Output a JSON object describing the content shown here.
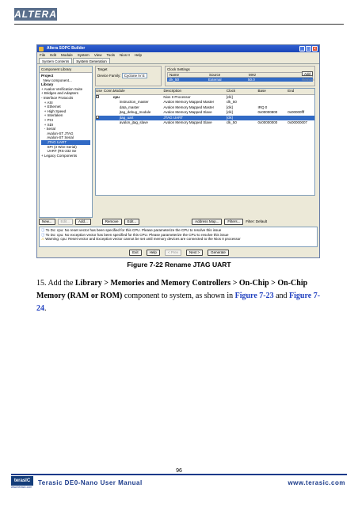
{
  "header": {
    "logo_text": "ALTERA"
  },
  "window": {
    "title": "Altera SOPC Builder",
    "menu": [
      "File",
      "Edit",
      "Module",
      "System",
      "View",
      "Tools",
      "Nios II",
      "Help"
    ],
    "tabs": [
      "System Contents",
      "System Generation"
    ],
    "library": {
      "title": "Component Library",
      "items": [
        {
          "text": "Project",
          "bold": true
        },
        {
          "text": "  New component..."
        },
        {
          "text": "Library",
          "bold": true
        },
        {
          "text": "+ Avalon Verification Suite"
        },
        {
          "text": "+ Bridges and Adapters"
        },
        {
          "text": "- Interface Protocols"
        },
        {
          "text": "   + ASI"
        },
        {
          "text": "   + Ethernet"
        },
        {
          "text": "   + High Speed"
        },
        {
          "text": "   + Interlaken"
        },
        {
          "text": "   + PCI"
        },
        {
          "text": "   + SDI"
        },
        {
          "text": "   - Serial"
        },
        {
          "text": "      Avalon-ST JTAG"
        },
        {
          "text": "      Avalon-ST Serial"
        },
        {
          "text": "      JTAG UART",
          "selected": true
        },
        {
          "text": "      SPI (3 Wire Serial)"
        },
        {
          "text": "      UART (RS-232 Se"
        },
        {
          "text": "+ Legacy Components"
        }
      ]
    },
    "target": {
      "title": "Target",
      "family_label": "Device Family:",
      "family_value": "Cyclone IV E"
    },
    "clock": {
      "title": "Clock Settings",
      "headers": [
        "Name",
        "Source",
        "MHz"
      ],
      "row": [
        "clk_50",
        "External",
        "50.0"
      ],
      "add": "Add",
      "remove": "Remove"
    },
    "table": {
      "headers": [
        "Use",
        "Conn...",
        "Module",
        "Description",
        "Clock",
        "Base",
        "End"
      ],
      "rows": [
        {
          "use": "",
          "module": "cpu",
          "desc": "Nios II Processor",
          "clock": "[clk]",
          "base": "",
          "end": "",
          "bold": true
        },
        {
          "use": "",
          "module": "instruction_master",
          "desc": "Avalon Memory Mapped Master",
          "clock": "clk_50",
          "base": "",
          "end": ""
        },
        {
          "use": "",
          "module": "data_master",
          "desc": "Avalon Memory Mapped Master",
          "clock": "[clk]",
          "base": "IRQ 0",
          "end": ""
        },
        {
          "use": "",
          "module": "jtag_debug_module",
          "desc": "Avalon Memory Mapped Slave",
          "clock": "[clk]",
          "base": "0x00000800",
          "end": "0x00000fff"
        },
        {
          "use": "",
          "module": "jtag_uart",
          "desc": "JTAG UART",
          "clock": "[clk]",
          "base": "",
          "end": "",
          "highlight": true
        },
        {
          "use": "",
          "module": "avalon_jtag_slave",
          "desc": "Avalon Memory Mapped Slave",
          "clock": "clk_50",
          "base": "0x00000000",
          "end": "0x00000007"
        }
      ]
    },
    "buttons": [
      "New...",
      "Edit...",
      "Add...",
      "Remove",
      "Edit...",
      "Address Map...",
      "Filters..."
    ],
    "filter_text": "Filter: Default",
    "messages": [
      "To Do: cpu: No reset vector has been specified for this CPU. Please parameterize the CPU to resolve this issue",
      "To Do: cpu: No exception vector has been specified for this CPU. Please parameterize the CPU to resolve this issue",
      "Warning: cpu: Reset vector and Exception vector cannot be set until memory devices are connected to the Nios II processor"
    ],
    "footer_buttons": [
      "Exit",
      "Help",
      "< Prev",
      "Next >",
      "Generate"
    ]
  },
  "caption": "Figure 7-22 Rename JTAG UART",
  "paragraph": {
    "num": "15. Add the ",
    "path": "Library > Memories and Memory Controllers > On-Chip > On-Chip Memory (RAM or ROM)",
    "mid": " component to system, as shown in ",
    "ref1": "Figure 7-23",
    "and": " and ",
    "ref2": "Figure 7-24",
    "end": "."
  },
  "footer": {
    "page": "96",
    "brand": "terasIC",
    "site_small": "www.terasic.com",
    "manual": "Terasic DE0-Nano User Manual",
    "www": "www.terasic.com"
  }
}
